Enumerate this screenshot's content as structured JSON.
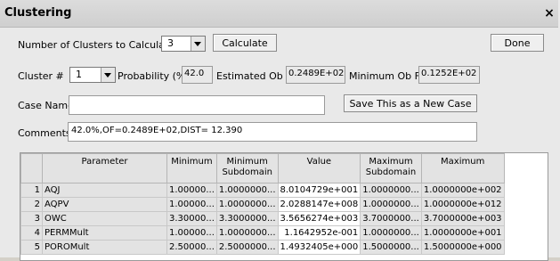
{
  "window": {
    "title": "Clustering",
    "close": "×"
  },
  "row1": {
    "label": "Number of Clusters to Calculate",
    "clusters_value": "3",
    "calculate_label": "Calculate",
    "done_label": "Done"
  },
  "row2": {
    "cluster_label": "Cluster #",
    "cluster_value": "1",
    "probability_label": "Probability (%)",
    "probability_value": "42.0",
    "est_label": "Estimated Ob Fn",
    "est_value": "0.2489E+02",
    "min_label": "Minimum Ob Fn",
    "min_value": "0.1252E+02"
  },
  "row3": {
    "case_label": "Case Name",
    "case_value": "",
    "save_label": "Save This as a New Case"
  },
  "row4": {
    "comments_label": "Comments",
    "comments_value": "42.0%,OF=0.2489E+02,DIST= 12.390"
  },
  "table": {
    "headers": [
      "",
      "Parameter",
      "Minimum",
      "Minimum Subdomain",
      "Value",
      "Maximum Subdomain",
      "Maximum"
    ],
    "rows": [
      [
        "1",
        "AQJ",
        "1.00000...",
        "1.0000000...",
        "8.0104729e+001",
        "1.0000000...",
        "1.0000000e+002"
      ],
      [
        "2",
        "AQPV",
        "1.00000...",
        "1.0000000...",
        "2.0288147e+008",
        "1.0000000...",
        "1.0000000e+012"
      ],
      [
        "3",
        "OWC",
        "3.30000...",
        "3.3000000...",
        "3.5656274e+003",
        "3.7000000...",
        "3.7000000e+003"
      ],
      [
        "4",
        "PERMMult",
        "1.00000...",
        "1.0000000...",
        "1.1642952e-001",
        "1.0000000...",
        "1.0000000e+001"
      ],
      [
        "5",
        "POROMult",
        "2.50000...",
        "2.5000000...",
        "1.4932405e+000",
        "1.5000000...",
        "1.5000000e+000"
      ]
    ]
  }
}
